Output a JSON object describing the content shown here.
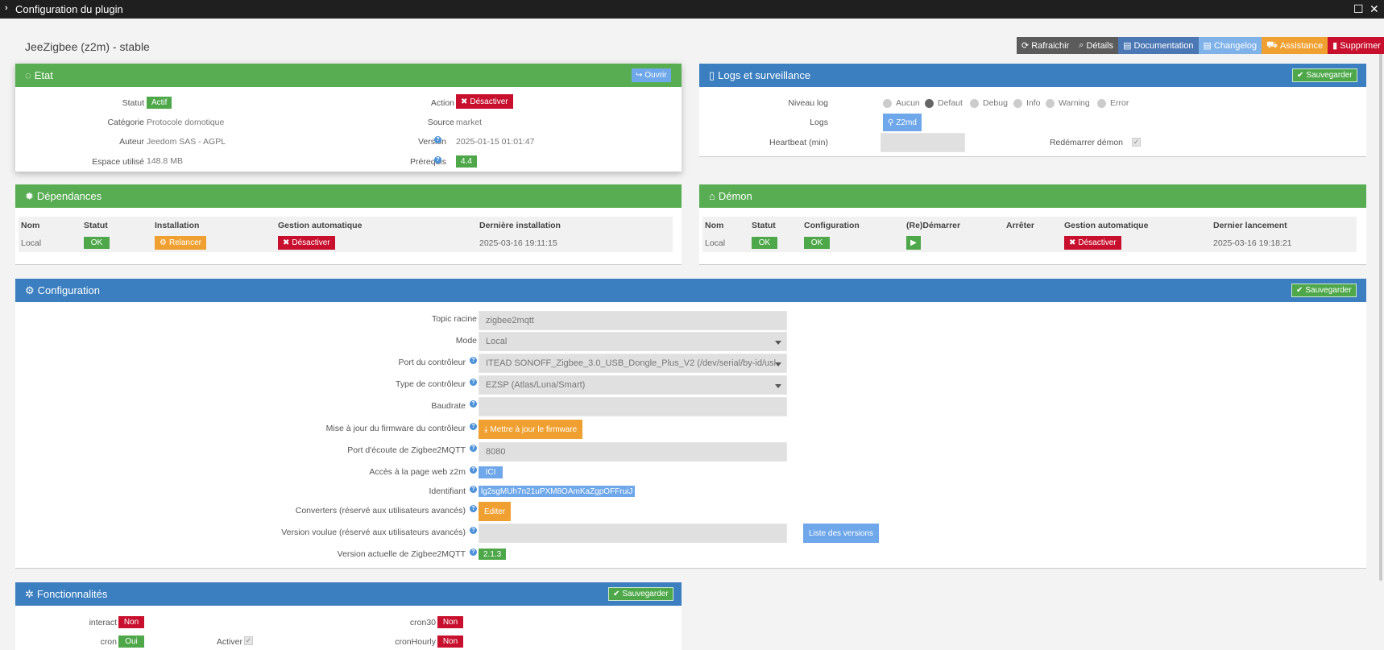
{
  "window": {
    "title": "Configuration du plugin",
    "chevron": "›",
    "maximize": "☐",
    "close": "✕"
  },
  "plugin_title": "JeeZigbee (z2m) - stable",
  "top_buttons": [
    {
      "label": "Rafraichir",
      "icon": "refresh-icon",
      "glyph": "⟳"
    },
    {
      "label": "Détails",
      "icon": "search-icon",
      "glyph": "⌕"
    },
    {
      "label": "Documentation",
      "icon": "book-icon",
      "glyph": "▤"
    },
    {
      "label": "Changelog",
      "icon": "file-icon",
      "glyph": "▤"
    },
    {
      "label": "Assistance",
      "icon": "truck-icon",
      "glyph": "⛟"
    },
    {
      "label": "Supprimer",
      "icon": "trash-icon",
      "glyph": "▮"
    }
  ],
  "etat": {
    "title": "Etat",
    "open_btn": "Ouvrir",
    "statut_label": "Statut",
    "statut_value": "Actif",
    "categorie_label": "Catégorie",
    "categorie_value": "Protocole domotique",
    "auteur_label": "Auteur",
    "auteur_value": "Jeedom SAS - AGPL",
    "espace_label": "Espace utilisé",
    "espace_value": "148.8 MB",
    "action_label": "Action",
    "action_btn": "Désactiver",
    "source_label": "Source",
    "source_value": "market",
    "version_label": "Version",
    "version_value": "2025-01-15 01:01:47",
    "prerequis_label": "Prérequis",
    "prerequis_value": "4.4"
  },
  "logs": {
    "title": "Logs et surveillance",
    "save_btn": "Sauvegarder",
    "niveau_label": "Niveau log",
    "levels": [
      "Aucun",
      "Defaut",
      "Debug",
      "Info",
      "Warning",
      "Error"
    ],
    "selected_level": "Defaut",
    "logs_label": "Logs",
    "logs_btn": "Z2md",
    "heartbeat_label": "Heartbeat (min)",
    "heartbeat_value": "",
    "restart_label": "Redémarrer démon"
  },
  "dependances": {
    "title": "Dépendances",
    "headers": [
      "Nom",
      "Statut",
      "Installation",
      "Gestion automatique",
      "Dernière installation"
    ],
    "row": {
      "nom": "Local",
      "statut": "OK",
      "installation": "Relancer",
      "gestion": "Désactiver",
      "derniere": "2025-03-16 19:11:15"
    }
  },
  "demon": {
    "title": "Démon",
    "headers": [
      "Nom",
      "Statut",
      "Configuration",
      "(Re)Démarrer",
      "Arrêter",
      "Gestion automatique",
      "Dernier lancement"
    ],
    "row": {
      "nom": "Local",
      "statut": "OK",
      "configuration": "OK",
      "gestion": "Désactiver",
      "dernier": "2025-03-16 19:18:21"
    }
  },
  "configuration": {
    "title": "Configuration",
    "save_btn": "Sauvegarder",
    "topic_label": "Topic racine",
    "topic_value": "zigbee2mqtt",
    "mode_label": "Mode",
    "mode_value": "Local",
    "port_label": "Port du contrôleur",
    "port_value": "ITEAD SONOFF_Zigbee_3.0_USB_Dongle_Plus_V2 (/dev/serial/by-id/usl",
    "type_label": "Type de contrôleur",
    "type_value": "EZSP (Atlas/Luna/Smart)",
    "baudrate_label": "Baudrate",
    "baudrate_value": "",
    "firmware_label": "Mise à jour du firmware du contrôleur",
    "firmware_btn": "Mettre à jour le firmware",
    "ecoute_label": "Port d'écoute de Zigbee2MQTT",
    "ecoute_value": "8080",
    "web_label": "Accès à la page web z2m",
    "web_btn": "ICI",
    "ident_label": "Identifiant",
    "ident_value": "lg2sgMUh7n21uPXM8OAmKaZgpOFFruiJ",
    "conv_label": "Converters (réservé aux utilisateurs avancés)",
    "conv_btn": "Editer",
    "vv_label": "Version voulue (réservé aux utilisateurs avancés)",
    "vv_value": "",
    "vv_btn": "Liste des versions",
    "va_label": "Version actuelle de Zigbee2MQTT",
    "va_value": "2.1.3"
  },
  "fonctionnalites": {
    "title": "Fonctionnalités",
    "save_btn": "Sauvegarder",
    "interact_label": "interact",
    "interact_value": "Non",
    "cron_label": "cron",
    "cron_value": "Oui",
    "activer_label": "Activer",
    "cron30_label": "cron30",
    "cron30_value": "Non",
    "cronhourly_label": "cronHourly",
    "cronhourly_value": "Non"
  },
  "colors": {
    "green": "#58ad52",
    "blue": "#3b7fc0",
    "red": "#c8102e",
    "orange": "#f0a030",
    "lightblue": "#6ea7ea"
  }
}
